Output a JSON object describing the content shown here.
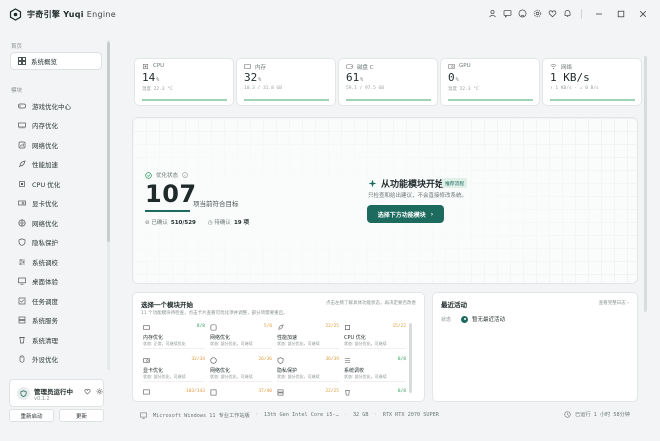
{
  "app": {
    "name_cn": "宇奇引擎",
    "name_en": "Yuqi",
    "name_suffix": "Engine"
  },
  "titlebar": {
    "icons": [
      "user-icon",
      "chat-icon",
      "github-icon",
      "settings-icon",
      "heart-icon",
      "bell-icon"
    ],
    "window_buttons": [
      "minimize-icon",
      "maximize-icon",
      "close-icon"
    ]
  },
  "sidebar": {
    "section_overview": "首页",
    "overview_item": "系统概览",
    "section_modules": "模块",
    "items": [
      {
        "label": "游戏优化中心",
        "icon": "gamepad-icon"
      },
      {
        "label": "内存优化",
        "icon": "memory-icon"
      },
      {
        "label": "网络优化",
        "icon": "network-icon"
      },
      {
        "label": "性能加速",
        "icon": "rocket-icon"
      },
      {
        "label": "CPU 优化",
        "icon": "cpu-icon"
      },
      {
        "label": "显卡优化",
        "icon": "gpu-icon"
      },
      {
        "label": "网络优化",
        "icon": "globe-icon"
      },
      {
        "label": "隐私保护",
        "icon": "shield-icon"
      },
      {
        "label": "系统调校",
        "icon": "sliders-icon"
      },
      {
        "label": "桌面体验",
        "icon": "monitor-icon"
      },
      {
        "label": "任务调度",
        "icon": "task-icon"
      },
      {
        "label": "系统服务",
        "icon": "service-icon"
      },
      {
        "label": "系统清理",
        "icon": "broom-icon"
      },
      {
        "label": "外设优化",
        "icon": "mouse-icon"
      }
    ],
    "status_name": "管理员运行中",
    "status_version": "v0.1.2",
    "restart_label": "重新启动",
    "update_label": "更新"
  },
  "metrics": [
    {
      "label": "CPU",
      "value": "14",
      "unit": "%",
      "sub": "温度 22.3 °C",
      "fill": 1.0,
      "icon": "cpu-icon"
    },
    {
      "label": "内存",
      "value": "32",
      "unit": "%",
      "sub": "10.3 / 31.8 GB",
      "fill": 1.0,
      "icon": "memory-icon"
    },
    {
      "label": "磁盘 C",
      "value": "61",
      "unit": "%",
      "sub": "59.1 / 97.5 GB",
      "fill": 1.0,
      "icon": "disk-icon"
    },
    {
      "label": "GPU",
      "value": "0",
      "unit": "%",
      "sub": "温度 22.3 °C",
      "fill": 1.0,
      "icon": "gpu-icon"
    },
    {
      "label": "网络",
      "value": "1 KB/s",
      "unit": "",
      "sub": "↑ 1 KB/s · ↓ 0 B/s",
      "fill": 1.0,
      "icon": "wifi-icon"
    }
  ],
  "hero": {
    "status_label": "优化状态",
    "score": "107",
    "score_desc": "项当前符合目标",
    "confirmed_label": "已确认",
    "confirmed_value": "510/529",
    "pending_label": "待确认",
    "pending_value": "19 项",
    "cta_title": "从功能模块开始",
    "cta_badge": "推荐流程",
    "cta_sub": "只检查和给出建议，不会直接修改系统。",
    "cta_button": "选择下方功能模块"
  },
  "modules_panel": {
    "title": "选择一个模块开始",
    "subtitle": "11 个功能模块待检查，点击卡片查看可优化项并调整，部分项需要重启。",
    "right_note": "点击左侧了解具体功能状态，再决定要否改善",
    "modules": [
      {
        "name": "内存优化",
        "count": "8/8",
        "ok": true,
        "desc": "状态: 正常，可继续优化",
        "icon": "memory-icon"
      },
      {
        "name": "网络优化",
        "count": "5/8",
        "ok": false,
        "desc": "状态: 部分优化，可继续",
        "icon": "network-icon"
      },
      {
        "name": "性能加速",
        "count": "22/25",
        "ok": false,
        "desc": "状态: 部分优化，可继续",
        "icon": "rocket-icon"
      },
      {
        "name": "CPU 优化",
        "count": "15/22",
        "ok": false,
        "desc": "状态: 部分优化，可继续",
        "icon": "cpu-icon"
      },
      {
        "name": "显卡优化",
        "count": "32/34",
        "ok": false,
        "desc": "状态: 部分优化，可继续",
        "icon": "gpu-icon"
      },
      {
        "name": "网络优化",
        "count": "26/36",
        "ok": false,
        "desc": "状态: 部分优化，可继续",
        "icon": "globe-icon"
      },
      {
        "name": "隐私保护",
        "count": "36/39",
        "ok": false,
        "desc": "状态: 部分优化，可继续",
        "icon": "shield-icon"
      },
      {
        "name": "系统调校",
        "count": "8/8",
        "ok": true,
        "desc": "状态: 部分优化，可继续",
        "icon": "sliders-icon"
      },
      {
        "name": "",
        "count": "103/143",
        "ok": false,
        "desc": "",
        "icon": "monitor-icon"
      },
      {
        "name": "",
        "count": "37/40",
        "ok": false,
        "desc": "",
        "icon": "task-icon"
      },
      {
        "name": "",
        "count": "22/25",
        "ok": false,
        "desc": "",
        "icon": "service-icon"
      },
      {
        "name": "",
        "count": "8/8",
        "ok": true,
        "desc": "",
        "icon": "broom-icon"
      }
    ]
  },
  "activity_panel": {
    "title": "最近活动",
    "right_link": "查看完整日志 ›",
    "status_col": "状态",
    "empty_text": "暂无最近活动"
  },
  "footer": {
    "os": "Microsoft Windows 11 专业工作站版",
    "cpu": "13th Gen Intel Core i5-…",
    "ram": "32 GB",
    "gpu": "RTX RTX 2070 SUPER",
    "uptime": "已运行 1 小时 58分钟"
  },
  "colors": {
    "accent": "#1d6b5e",
    "warn": "#e29b3b",
    "ok": "#2e9e63"
  }
}
